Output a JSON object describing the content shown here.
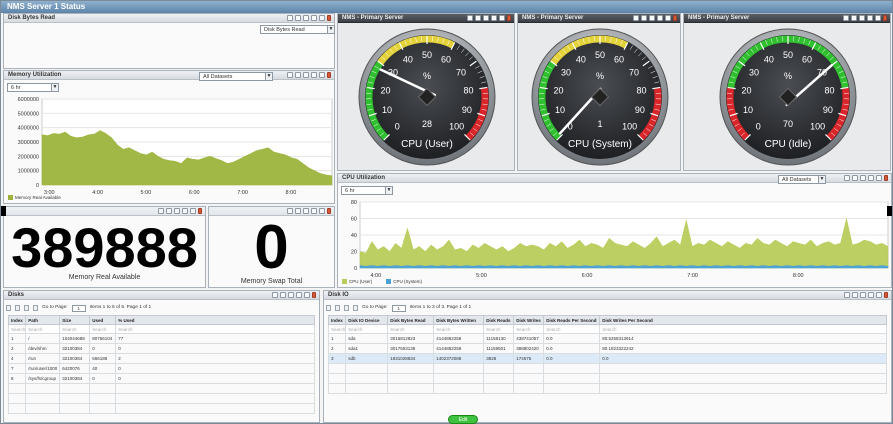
{
  "app": {
    "title": "NMS Server 1 Status"
  },
  "disk_bytes_read": {
    "title": "Disk Bytes Read",
    "selector": "Disk Bytes Read"
  },
  "memory": {
    "title": "Memory Utilization",
    "range": "6 hr",
    "dataset": "All Datasets",
    "legend": "Memory Real Available"
  },
  "gauges": [
    {
      "panel_title": "NMS - Primary Server",
      "label": "CPU (User)",
      "reading": "28",
      "value": 28
    },
    {
      "panel_title": "NMS - Primary Server",
      "label": "CPU (System)",
      "reading": "1",
      "value": 1
    },
    {
      "panel_title": "NMS - Primary Server",
      "label": "CPU (Idle)",
      "reading": "70",
      "value": 70
    }
  ],
  "gauge_ticks": [
    "0",
    "10",
    "20",
    "30",
    "40",
    "50",
    "60",
    "70",
    "80",
    "90",
    "100"
  ],
  "gauge_unit": "%",
  "cpu": {
    "title": "CPU Utilization",
    "range": "6 hr",
    "dataset": "All Datasets",
    "legend_user": "CPU (User)",
    "legend_system": "CPU (System)"
  },
  "stats": {
    "mem_real_value": "389888",
    "mem_real_label": "Memory Real Available",
    "swap_value": "0",
    "swap_label": "Memory Swap Total"
  },
  "disks": {
    "title": "Disks",
    "goto": "Go to Page:",
    "page": "1",
    "items": "Items 1 to 5 of 5. Page 1 of 1",
    "columns": [
      "Index",
      "Path",
      "Size",
      "Used",
      "% Used"
    ],
    "search": "Search",
    "rows": [
      [
        "1",
        "/",
        "104044688",
        "80756104",
        "77"
      ],
      [
        "2",
        "/dev/shm",
        "32100384",
        "0",
        "0"
      ],
      [
        "4",
        "/run",
        "32100384",
        "566188",
        "2"
      ],
      [
        "7",
        "/run/user/1000",
        "6420076",
        "40",
        "0"
      ],
      [
        "8",
        "/sys/fs/cgroup",
        "32100384",
        "0",
        "0"
      ]
    ]
  },
  "diskio": {
    "title": "Disk IO",
    "goto": "Go to Page:",
    "page": "1",
    "items": "Items 1 to 3 of 3. Page 1 of 1",
    "columns": [
      "Index",
      "Disk IO Device",
      "Disk Bytes Read",
      "Disk Bytes Written",
      "Disk Reads",
      "Disk Writes",
      "Disk Reads Per Second",
      "Disk Writes Per Second"
    ],
    "search": "Search",
    "rows": [
      [
        "1",
        "sda",
        "3015812823",
        "4144882258",
        "11158130",
        "438741057",
        "0.0",
        "80.5258313914"
      ],
      [
        "2",
        "sda1",
        "3017553138",
        "4144882258",
        "11159501",
        "388802420",
        "0.0",
        "80.1823322242"
      ],
      [
        "3",
        "sdb",
        "1831028834",
        "1402372088",
        "3828",
        "174675",
        "0.0",
        "0.0"
      ]
    ]
  },
  "footer": {
    "badge": "Edit"
  },
  "chart_data": [
    {
      "type": "area",
      "title": "Memory Utilization",
      "series": [
        {
          "name": "Memory Real Available",
          "color": "#9cb43c",
          "values": [
            3500000,
            3450000,
            3600000,
            3550000,
            3700000,
            3400000,
            3300000,
            3350000,
            3500000,
            3550000,
            3800000,
            3600000,
            3300000,
            2800000,
            2500000,
            2600000,
            2400000,
            2200000,
            2100000,
            2300000,
            2000000,
            1800000,
            1700000,
            1650000,
            1500000,
            1900000,
            1800000,
            1750000,
            1900000,
            2000000,
            1850000,
            1700000,
            1500000,
            1600000,
            1800000,
            2000000,
            2200000,
            2400000,
            2500000,
            2600000,
            2300000,
            2200000,
            2100000,
            1900000,
            1800000,
            1500000,
            1200000,
            1000000,
            800000,
            700000,
            650000
          ]
        }
      ],
      "x_ticks": [
        "3:00",
        "4:00",
        "5:00",
        "6:00",
        "7:00",
        "8:00"
      ],
      "y_ticks": [
        "0",
        "1000000",
        "2000000",
        "3000000",
        "4000000",
        "5000000",
        "6000000"
      ],
      "ylim": [
        0,
        6000000
      ]
    },
    {
      "type": "area",
      "title": "CPU Utilization",
      "series": [
        {
          "name": "CPU (User)",
          "color": "#b8cc5a",
          "values": [
            20,
            18,
            32,
            22,
            26,
            20,
            30,
            24,
            48,
            22,
            26,
            20,
            28,
            22,
            26,
            34,
            22,
            24,
            20,
            28,
            24,
            30,
            26,
            22,
            26,
            20,
            24,
            30,
            26,
            28,
            26,
            22,
            30,
            26,
            32,
            24,
            28,
            34,
            26,
            30,
            28,
            24,
            36,
            30,
            28,
            26,
            32,
            28,
            24,
            30,
            38,
            26,
            30,
            34,
            28,
            58,
            26,
            30,
            28,
            34,
            30,
            26,
            32,
            28,
            24,
            30,
            28,
            36,
            30,
            28,
            34,
            30,
            26,
            32,
            30,
            28,
            34,
            26,
            30,
            32,
            28,
            30,
            60,
            28,
            30,
            34,
            32,
            28,
            30,
            26
          ]
        },
        {
          "name": "CPU (System)",
          "color": "#4aa0d8",
          "values": [
            3,
            2,
            3,
            2,
            3,
            2,
            3,
            2,
            3,
            2,
            3,
            2,
            3,
            2,
            3,
            2,
            3,
            2,
            3,
            2,
            3,
            2,
            3,
            2,
            3,
            2,
            3,
            2,
            3,
            2,
            3,
            2,
            3,
            2,
            3,
            2,
            3,
            2,
            3,
            2,
            3,
            2,
            3,
            2,
            3,
            2,
            3,
            2,
            3,
            2,
            3,
            2,
            3,
            2,
            3,
            2,
            3,
            2,
            3,
            2,
            3,
            2,
            3,
            2,
            3,
            2,
            3,
            2,
            3,
            2,
            3,
            2,
            3,
            2,
            3,
            2,
            3,
            2,
            3,
            2,
            3,
            2,
            3,
            2,
            3,
            2,
            3,
            2,
            3,
            2
          ]
        }
      ],
      "x_ticks": [
        "4:00",
        "5:00",
        "6:00",
        "7:00",
        "8:00"
      ],
      "y_ticks": [
        "0",
        "20",
        "40",
        "60",
        "80"
      ],
      "ylim": [
        0,
        80
      ]
    }
  ]
}
